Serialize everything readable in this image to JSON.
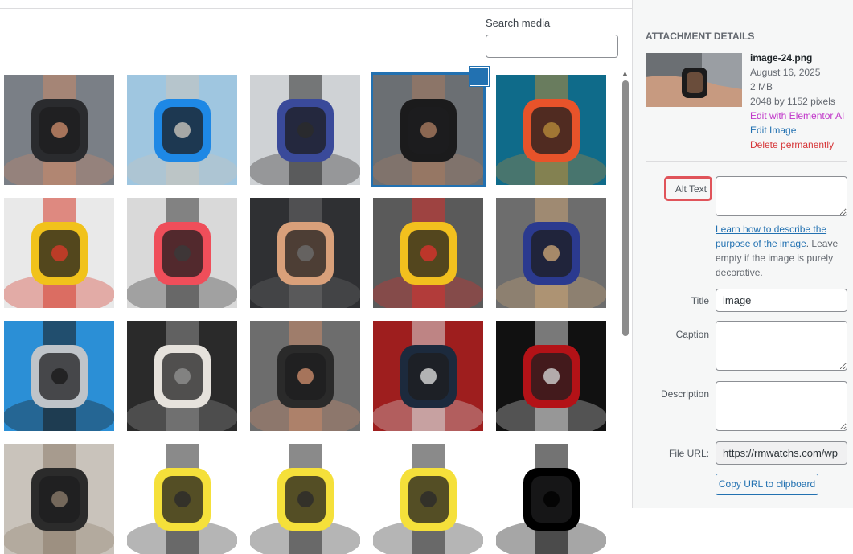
{
  "search": {
    "label": "Search media",
    "value": "",
    "placeholder": ""
  },
  "media_grid": {
    "tiles": [
      {
        "id": 1,
        "palette": [
          "#7a7f86",
          "#2a2b2e",
          "#c88a6a"
        ],
        "selected": false
      },
      {
        "id": 2,
        "palette": [
          "#9fc6e0",
          "#1e88e5",
          "#c9c4bb"
        ],
        "selected": false
      },
      {
        "id": 3,
        "palette": [
          "#cfd2d5",
          "#3a4a9a",
          "#2a2a2a"
        ],
        "selected": false
      },
      {
        "id": 4,
        "palette": [
          "#6b6f73",
          "#1b1b1c",
          "#a87a5f"
        ],
        "selected": true
      },
      {
        "id": 5,
        "palette": [
          "#0f6b8a",
          "#e8532a",
          "#b58a3a"
        ],
        "selected": false
      },
      {
        "id": 6,
        "palette": [
          "#e9e9e9",
          "#f1c21b",
          "#d63a2a"
        ],
        "selected": false
      },
      {
        "id": 7,
        "palette": [
          "#d9d9d9",
          "#ef4e5a",
          "#3a3a3a"
        ],
        "selected": false
      },
      {
        "id": 8,
        "palette": [
          "#2f3033",
          "#d9a07a",
          "#6b6b6b"
        ],
        "selected": false
      },
      {
        "id": 9,
        "palette": [
          "#5a5a5a",
          "#f2c01e",
          "#d7322d"
        ],
        "selected": false
      },
      {
        "id": 10,
        "palette": [
          "#6d6d6d",
          "#2b3a8f",
          "#c8a276"
        ],
        "selected": false
      },
      {
        "id": 11,
        "palette": [
          "#2b8fd6",
          "#bfc4c9",
          "#1a1a1a"
        ],
        "selected": false
      },
      {
        "id": 12,
        "palette": [
          "#2a2a2a",
          "#e6e2dc",
          "#8e8e8e"
        ],
        "selected": false
      },
      {
        "id": 13,
        "palette": [
          "#6d6d6d",
          "#2a2a2a",
          "#c88a6a"
        ],
        "selected": false
      },
      {
        "id": 14,
        "palette": [
          "#9e1e1e",
          "#1c2a3d",
          "#d8d8d8"
        ],
        "selected": false
      },
      {
        "id": 15,
        "palette": [
          "#111111",
          "#b31217",
          "#cfcfcf"
        ],
        "selected": false
      },
      {
        "id": 16,
        "palette": [
          "#c9c3bb",
          "#2b2b2b",
          "#8a7a6a"
        ],
        "selected": false
      },
      {
        "id": 17,
        "palette": [
          "#ffffff",
          "#f5e03a",
          "#2a2a2a"
        ],
        "selected": false
      },
      {
        "id": 18,
        "palette": [
          "#ffffff",
          "#f5e03a",
          "#2a2a2a"
        ],
        "selected": false
      },
      {
        "id": 19,
        "palette": [
          "#ffffff",
          "#f5e03a",
          "#2a2a2a"
        ],
        "selected": false
      },
      {
        "id": 20,
        "palette": [
          "#ffffff",
          "#000000",
          "#000000"
        ],
        "selected": false
      }
    ]
  },
  "sidebar": {
    "heading": "ATTACHMENT DETAILS",
    "file": {
      "name": "image-24.png",
      "date": "August 16, 2025",
      "size": "2 MB",
      "dimensions": "2048 by 1152 pixels",
      "edit_ai": "Edit with Elementor AI",
      "edit_image": "Edit Image",
      "delete": "Delete permanently"
    },
    "fields": {
      "alt_label": "Alt Text",
      "alt_value": "",
      "help_link": "Learn how to describe the purpose of the image",
      "help_text": ". Leave empty if the image is purely decorative.",
      "title_label": "Title",
      "title_value": "image",
      "caption_label": "Caption",
      "caption_value": "",
      "description_label": "Description",
      "description_value": "",
      "url_label": "File URL:",
      "url_value": "https://rmwatchs.com/wp",
      "copy_button": "Copy URL to clipboard"
    }
  },
  "colors": {
    "accent": "#2271b1",
    "highlight": "#e0545a",
    "delete": "#d63638",
    "ai": "#c036c9"
  }
}
